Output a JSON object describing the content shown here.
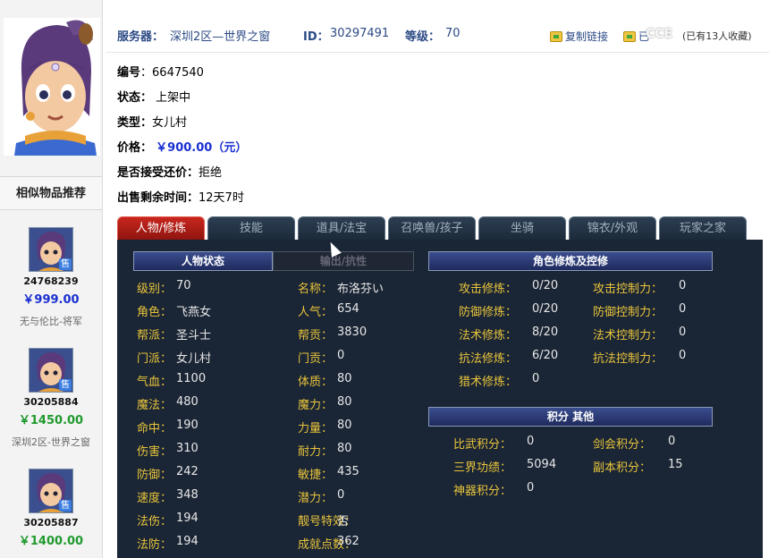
{
  "header": {
    "server_label": "服务器：",
    "server_value": "深圳2区—世界之窗",
    "id_label": "ID：",
    "id_value": "30297491",
    "level_label": "等级：",
    "level_value": "70",
    "copy_link": "复制链接",
    "collect": "已",
    "fav_count": "(已有13人收藏)",
    "watermark": "CCE"
  },
  "info": {
    "serial_label": "编号",
    "serial_value": "6647540",
    "status_label": "状态：",
    "status_value": "上架中",
    "type_label": "类型：",
    "type_value": "女儿村",
    "price_label": "价格：",
    "price_value": "￥900.00（元）",
    "bargain_label": "是否接受还价：",
    "bargain_value": "拒绝",
    "remain_label": "出售剩余时间：",
    "remain_value": "12天7时"
  },
  "sidebar": {
    "title": "相似物品推荐",
    "sold_label": "售",
    "items": [
      {
        "id": "24768239",
        "price": "￥999.00",
        "note": "无与伦比-将军"
      },
      {
        "id": "30205884",
        "price": "￥1450.00",
        "note": "深圳2区-世界之窗"
      },
      {
        "id": "30205887",
        "price": "￥1400.00",
        "note": ""
      }
    ]
  },
  "tabs": [
    "人物/修炼",
    "技能",
    "道具/法宝",
    "召唤兽/孩子",
    "坐骑",
    "锦衣/外观",
    "玩家之家"
  ],
  "panel": {
    "char_status_title": "人物状态",
    "output_title": "输出/抗性",
    "cultivation_title": "角色修炼及控修",
    "score_title": "积分 其他",
    "left_col": [
      {
        "k": "级别：",
        "v": "70"
      },
      {
        "k": "角色：",
        "v": "飞燕女"
      },
      {
        "k": "帮派：",
        "v": "圣斗士"
      },
      {
        "k": "门派：",
        "v": "女儿村"
      },
      {
        "k": "气血：",
        "v": "1100"
      },
      {
        "k": "魔法：",
        "v": "480"
      },
      {
        "k": "命中：",
        "v": "190"
      },
      {
        "k": "伤害：",
        "v": "310"
      },
      {
        "k": "防御：",
        "v": "242"
      },
      {
        "k": "速度：",
        "v": "348"
      },
      {
        "k": "法伤：",
        "v": "194"
      },
      {
        "k": "法防：",
        "v": "194"
      }
    ],
    "mid_col": [
      {
        "k": "名称：",
        "v": "布洛芬い"
      },
      {
        "k": "人气：",
        "v": "654"
      },
      {
        "k": "帮贡：",
        "v": "3830"
      },
      {
        "k": "门贡：",
        "v": "0"
      },
      {
        "k": "体质：",
        "v": "80"
      },
      {
        "k": "魔力：",
        "v": "80"
      },
      {
        "k": "力量：",
        "v": "80"
      },
      {
        "k": "耐力：",
        "v": "80"
      },
      {
        "k": "敏捷：",
        "v": "435"
      },
      {
        "k": "潜力：",
        "v": "0"
      },
      {
        "k": "靓号特效：",
        "v": "否"
      },
      {
        "k": "成就点数：",
        "v": "362"
      }
    ],
    "cult_left": [
      {
        "k": "攻击修炼：",
        "v": "0/20"
      },
      {
        "k": "防御修炼：",
        "v": "0/20"
      },
      {
        "k": "法术修炼：",
        "v": "8/20"
      },
      {
        "k": "抗法修炼：",
        "v": "6/20"
      },
      {
        "k": "猎术修炼：",
        "v": "0"
      }
    ],
    "cult_right": [
      {
        "k": "攻击控制力：",
        "v": "0"
      },
      {
        "k": "防御控制力：",
        "v": "0"
      },
      {
        "k": "法术控制力：",
        "v": "0"
      },
      {
        "k": "抗法控制力：",
        "v": "0"
      }
    ],
    "score_left": [
      {
        "k": "比武积分：",
        "v": "0"
      },
      {
        "k": "三界功绩：",
        "v": "5094"
      },
      {
        "k": "神器积分：",
        "v": "0"
      }
    ],
    "score_right": [
      {
        "k": "剑会积分：",
        "v": "0"
      },
      {
        "k": "副本积分：",
        "v": "15"
      }
    ]
  }
}
